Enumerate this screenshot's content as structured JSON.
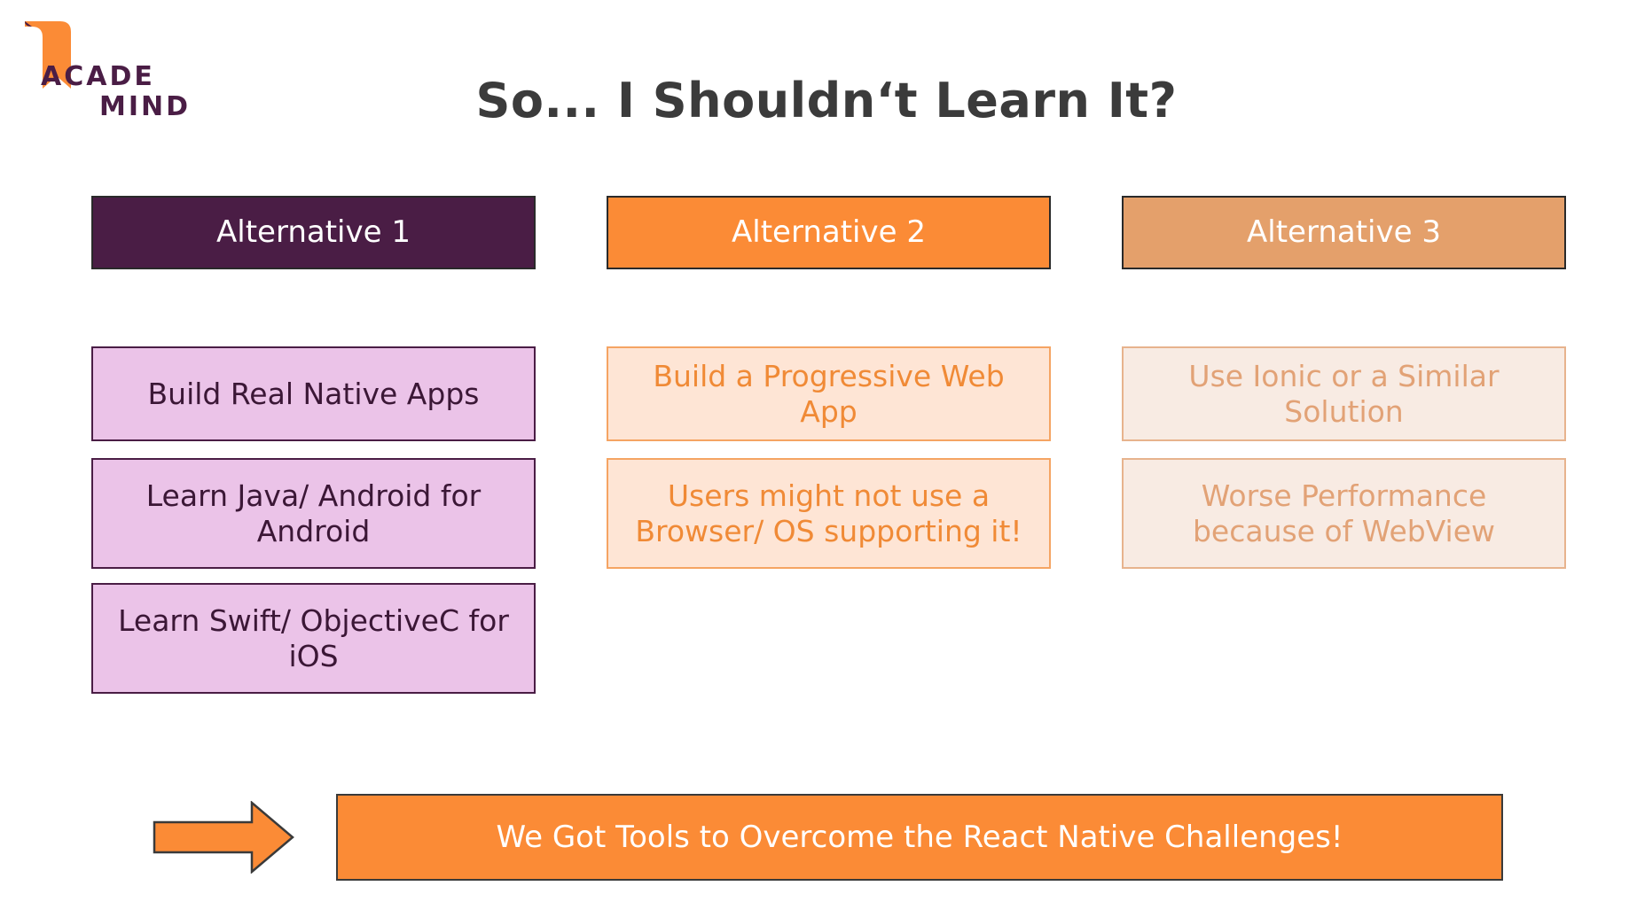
{
  "logo": {
    "line1": "ACADE",
    "line2": "MIND"
  },
  "title": "So... I Shouldn‘t Learn It?",
  "alternatives": [
    {
      "header": "Alternative 1",
      "items": [
        "Build Real Native Apps",
        "Learn Java/ Android for Android",
        "Learn Swift/ ObjectiveC for iOS"
      ]
    },
    {
      "header": "Alternative 2",
      "items": [
        "Build a Progressive Web App",
        "Users might not use a Browser/ OS supporting it!"
      ]
    },
    {
      "header": "Alternative 3",
      "items": [
        "Use Ionic or a Similar Solution",
        "Worse Performance because of WebView"
      ]
    }
  ],
  "banner": "We Got Tools to Overcome the React Native Challenges!",
  "colors": {
    "primary_purple": "#4a1d45",
    "primary_orange": "#fb8b36",
    "muted_orange": "#e4a06b",
    "light_purple": "#ebc3e8",
    "light_orange": "#fee5d5",
    "lightest_orange": "#f8ebe3"
  }
}
